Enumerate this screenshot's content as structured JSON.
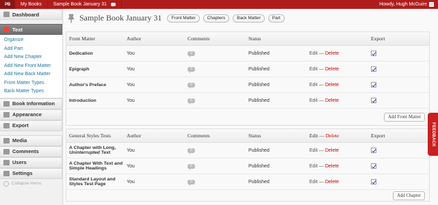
{
  "adminbar": {
    "logo": "PB",
    "items": [
      "My Books",
      "Sample Book January 31"
    ],
    "howdy": "Howdy, Hugh McGuire"
  },
  "sidebar": {
    "dashboard": "Dashboard",
    "text": "Text",
    "text_sub": [
      "Organize",
      "Add Part",
      "Add New Chapter",
      "Add New Front Matter",
      "Add New Back Matter",
      "Front Matter Types",
      "Back Matter Types"
    ],
    "book_information": "Book Information",
    "appearance": "Appearance",
    "export": "Export",
    "media": "Media",
    "comments": "Comments",
    "users": "Users",
    "settings": "Settings",
    "collapse": "Collapse menu"
  },
  "header": {
    "title": "Sample Book January 31",
    "buttons": [
      "Front Matter",
      "Chapters",
      "Back Matter",
      "Part"
    ]
  },
  "front_matter": {
    "columns": [
      "Front Matter",
      "Author",
      "Comments",
      "Status",
      "",
      "Export"
    ],
    "rows": [
      {
        "name": "Dedication",
        "author": "You",
        "comments": "0",
        "status": "Published",
        "edit": "Edit",
        "sep": "—",
        "delete": "Delete"
      },
      {
        "name": "Epigraph",
        "author": "You",
        "comments": "0",
        "status": "Published",
        "edit": "Edit",
        "sep": "—",
        "delete": "Delete"
      },
      {
        "name": "Author's Preface",
        "author": "You",
        "comments": "0",
        "status": "Published",
        "edit": "Edit",
        "sep": "—",
        "delete": "Delete"
      },
      {
        "name": "Introduction",
        "author": "You",
        "comments": "0",
        "status": "Published",
        "edit": "Edit",
        "sep": "—",
        "delete": "Delete"
      }
    ],
    "add_button": "Add Front Matter"
  },
  "chapters": {
    "columns": [
      "General Styles Tests",
      "Author",
      "Comments",
      "Status",
      "Edit",
      "Export"
    ],
    "header_sep": "—",
    "header_delete": "Delete",
    "rows": [
      {
        "name_a": "A Chapter with Long, ",
        "name_b": "Uninterrupted",
        "name_c": " Text",
        "author": "You",
        "comments": "0",
        "status": "Published",
        "edit": "Edit",
        "sep": "—",
        "delete": "Delete"
      },
      {
        "name_a": "A Chapter With Text and Simple Headings",
        "name_b": "",
        "name_c": "",
        "author": "You",
        "comments": "0",
        "status": "Published",
        "edit": "Edit",
        "sep": "—",
        "delete": "Delete"
      },
      {
        "name_a": "Standard Layout and Styles Test Page",
        "name_b": "",
        "name_c": "",
        "author": "You",
        "comments": "0",
        "status": "Published",
        "edit": "Edit",
        "sep": "—",
        "delete": "Delete"
      }
    ],
    "add_button": "Add Chapter"
  },
  "feedback": "FEEDBACK",
  "colors": {
    "adminbar": "#b01d1d",
    "link": "#21759b",
    "delete": "#cc0000",
    "feedback": "#c92020"
  }
}
